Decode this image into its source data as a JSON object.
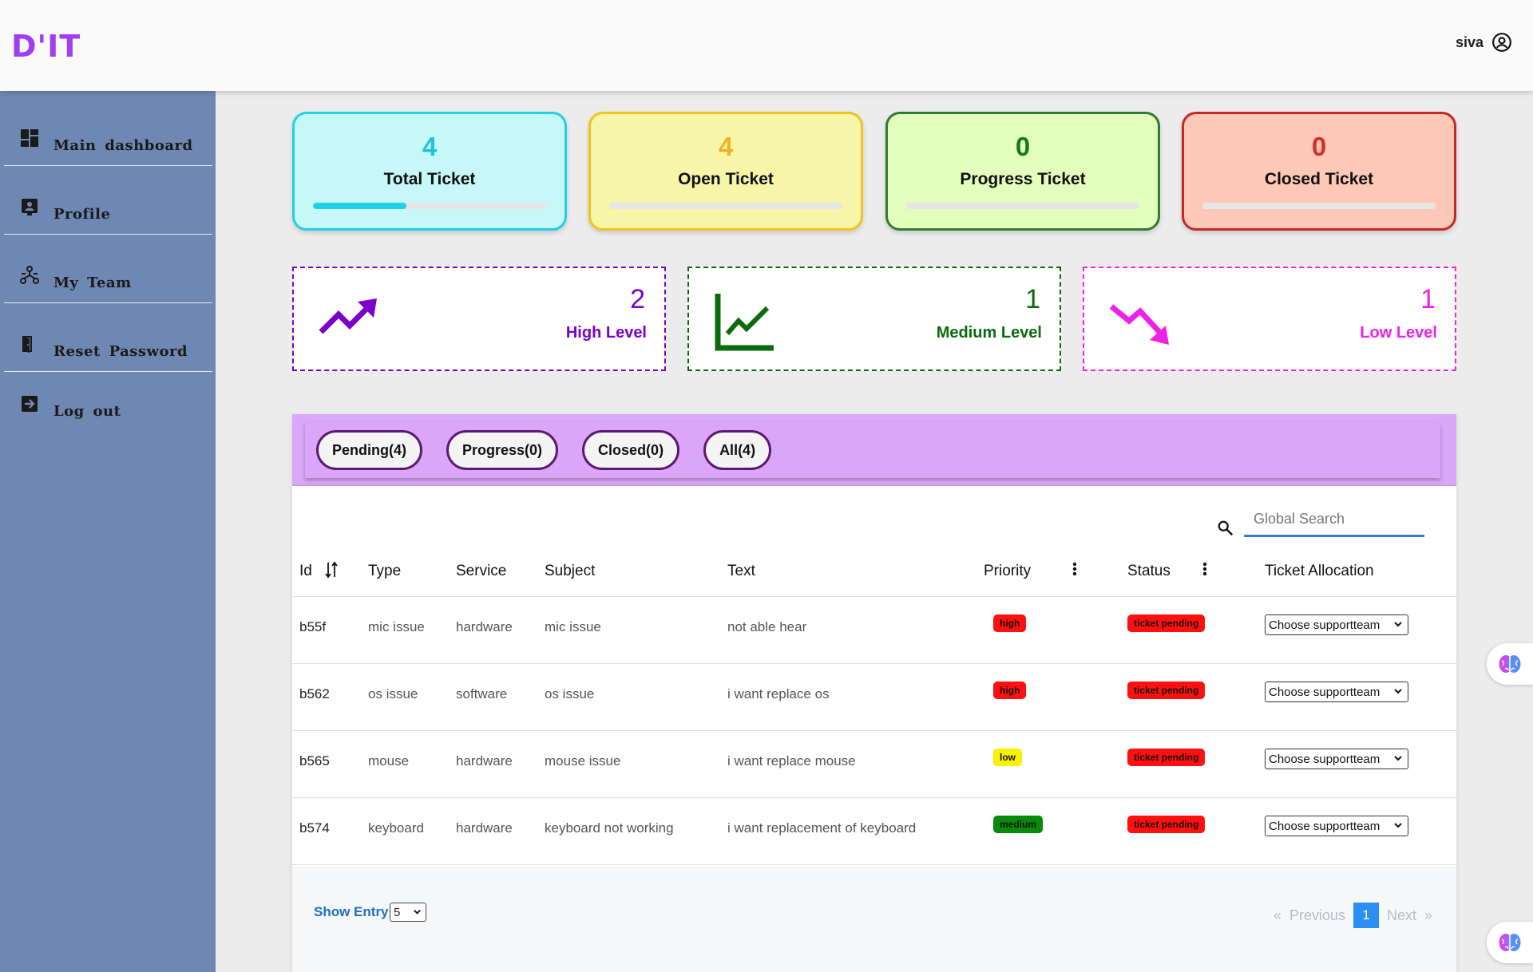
{
  "app": {
    "logo": "D'IT",
    "user_name": "siva"
  },
  "sidebar": {
    "items": [
      {
        "label": "Main dashboard"
      },
      {
        "label": "Profile"
      },
      {
        "label": "My Team"
      },
      {
        "label": "Reset Password"
      },
      {
        "label": "Log out"
      }
    ]
  },
  "stats": [
    {
      "value": "4",
      "title": "Total Ticket",
      "progress_fraction": 0.4,
      "color": "#1ec3d9",
      "bg": "#c7f8f8",
      "border": "#1fd0e6"
    },
    {
      "value": "4",
      "title": "Open Ticket",
      "progress_fraction": 0,
      "color": "#f0b323",
      "bg": "#f7f5a8",
      "border": "#f2c21f"
    },
    {
      "value": "0",
      "title": "Progress Ticket",
      "progress_fraction": 0,
      "color": "#1a7a1a",
      "bg": "#e3fdbc",
      "border": "#2e7d32"
    },
    {
      "value": "0",
      "title": "Closed Ticket",
      "progress_fraction": 0,
      "color": "#d32f2f",
      "bg": "#fdc9b6",
      "border": "#c62828"
    }
  ],
  "levels": [
    {
      "value": "2",
      "label": "High Level",
      "color": "#7b00c9",
      "icon": "trending-up-icon"
    },
    {
      "value": "1",
      "label": "Medium Level",
      "color": "#0b6a0b",
      "icon": "line-chart-icon"
    },
    {
      "value": "1",
      "label": "Low Level",
      "color": "#f020e8",
      "icon": "trending-down-icon"
    }
  ],
  "tabs": [
    "Pending(4)",
    "Progress(0)",
    "Closed(0)",
    "All(4)"
  ],
  "search": {
    "placeholder": "Global Search"
  },
  "table": {
    "columns": [
      "Id",
      "Type",
      "Service",
      "Subject",
      "Text",
      "Priority",
      "Status",
      "Ticket Allocation"
    ],
    "rows": [
      {
        "id": "b55f",
        "type": "mic issue",
        "service": "hardware",
        "subject": "mic issue",
        "text": "not able hear",
        "priority": "high",
        "status": "ticket pending",
        "allocation": "Choose supportteam"
      },
      {
        "id": "b562",
        "type": "os issue",
        "service": "software",
        "subject": "os issue",
        "text": "i want replace os",
        "priority": "high",
        "status": "ticket pending",
        "allocation": "Choose supportteam"
      },
      {
        "id": "b565",
        "type": "mouse",
        "service": "hardware",
        "subject": "mouse issue",
        "text": "i want replace mouse",
        "priority": "low",
        "status": "ticket pending",
        "allocation": "Choose supportteam"
      },
      {
        "id": "b574",
        "type": "keyboard",
        "service": "hardware",
        "subject": "keyboard not working",
        "text": "i want replacement of keyboard",
        "priority": "medium",
        "status": "ticket pending",
        "allocation": "Choose supportteam"
      }
    ],
    "priority_colors": {
      "high": "#ff1010",
      "low": "#f7f200",
      "medium": "#0a8a0a"
    },
    "status_color": "#ff1010"
  },
  "footer": {
    "show_entry_label": "Show Entry",
    "entry_value": "5",
    "prev_arrow": "«",
    "prev_label": "Previous",
    "page": "1",
    "next_label": "Next",
    "next_arrow": "»"
  }
}
